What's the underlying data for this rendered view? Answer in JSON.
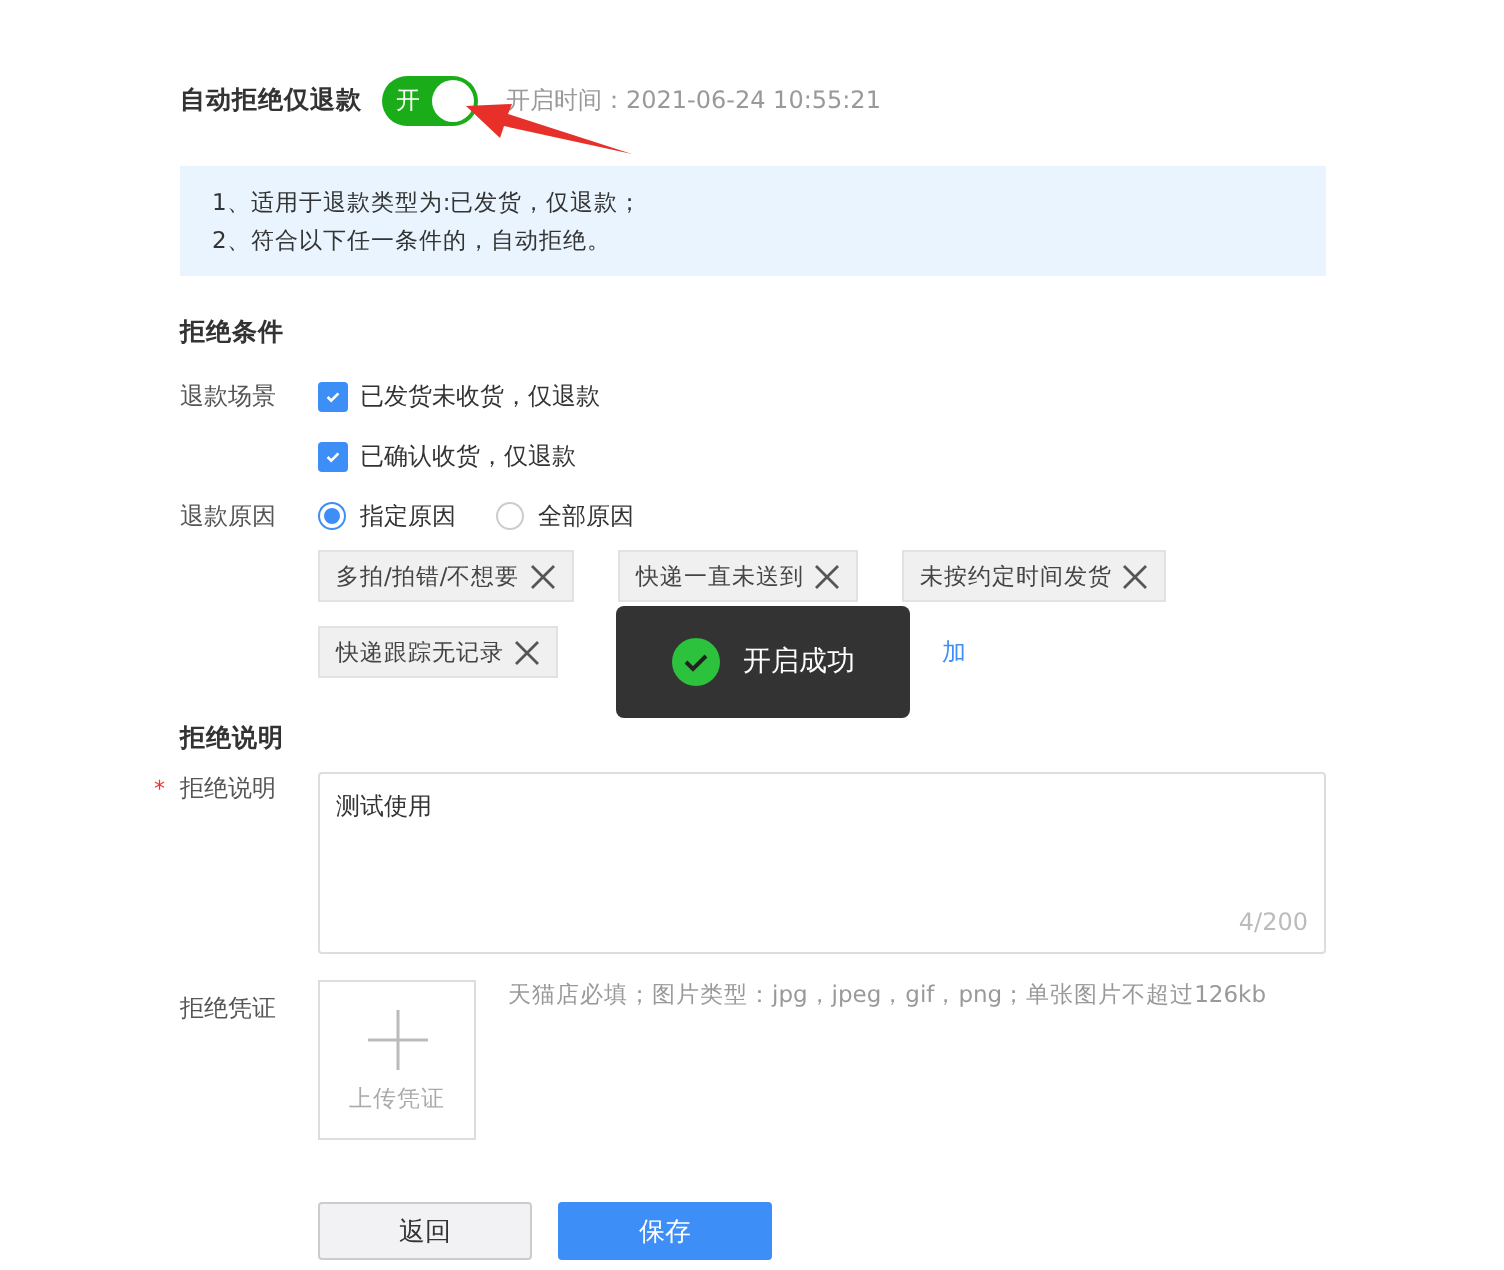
{
  "auto_reject": {
    "label": "自动拒绝仅退款",
    "switch": {
      "label": "开",
      "on": true
    },
    "enabled_time": "开启时间：2021-06-24 10:55:21"
  },
  "notice": [
    "1、适用于退款类型为:已发货，仅退款；",
    "2、符合以下任一条件的，自动拒绝。"
  ],
  "conditions": {
    "title": "拒绝条件",
    "scene": {
      "label": "退款场景",
      "options": [
        {
          "label": "已发货未收货，仅退款",
          "checked": true
        },
        {
          "label": "已确认收货，仅退款",
          "checked": true
        }
      ]
    },
    "reason": {
      "label": "退款原因",
      "options": [
        {
          "label": "指定原因",
          "selected": true
        },
        {
          "label": "全部原因",
          "selected": false
        }
      ],
      "tags": [
        "多拍/拍错/不想要",
        "快递一直未送到",
        "未按约定时间发货",
        "快递跟踪无记录"
      ],
      "add_link": "加"
    }
  },
  "explanation": {
    "title": "拒绝说明",
    "label": "拒绝说明",
    "required_mark": "*",
    "value": "测试使用",
    "counter": "4/200"
  },
  "evidence": {
    "label": "拒绝凭证",
    "upload_label": "上传凭证",
    "hint": "天猫店必填；图片类型：jpg，jpeg，gif，png；单张图片不超过126kb"
  },
  "buttons": [
    {
      "label": "返回",
      "kind": "default"
    },
    {
      "label": "保存",
      "kind": "primary"
    }
  ],
  "toast": {
    "message": "开启成功"
  }
}
